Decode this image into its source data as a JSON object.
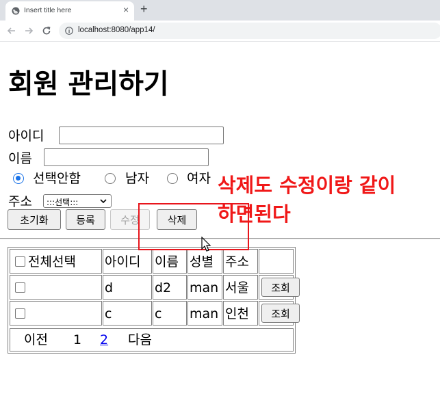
{
  "browser": {
    "tab_title": "Insert title here",
    "tab_close": "×",
    "new_tab": "+",
    "url": "localhost:8080/app14/"
  },
  "page": {
    "title": "회원 관리하기",
    "id_label": "아이디",
    "name_label": "이름",
    "gender_options": [
      "선택안함",
      "남자",
      "여자"
    ],
    "gender_selected": 0,
    "address_label": "주소",
    "address_select_value": ":::선택:::",
    "buttons": {
      "reset": "초기화",
      "register": "등록",
      "edit": "수정",
      "delete": "삭제"
    }
  },
  "table": {
    "headers": [
      "전체선택",
      "아이디",
      "이름",
      "성별",
      "주소"
    ],
    "rows": [
      {
        "id": "d",
        "name": "d2",
        "gender": "man",
        "address": "서울",
        "action": "조회"
      },
      {
        "id": "c",
        "name": "c",
        "gender": "man",
        "address": "인천",
        "action": "조회"
      }
    ],
    "pager": {
      "prev": "이전",
      "pages": [
        "1",
        "2"
      ],
      "next": "다음"
    }
  },
  "annotation": {
    "line1": "삭제도 수정이랑 같이",
    "line2": "하면된다",
    "color": "#f01818"
  }
}
